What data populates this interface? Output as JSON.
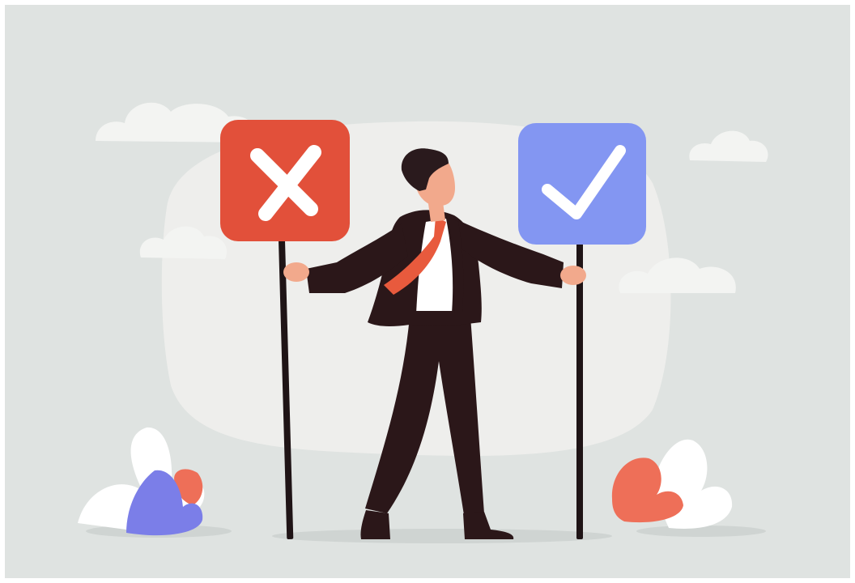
{
  "scene": {
    "subject": "businessman",
    "left_sign_icon": "x-mark-icon",
    "right_sign_icon": "check-mark-icon"
  },
  "colors": {
    "background": "#dfe3e1",
    "backdrop_blob": "#eeeeec",
    "cloud": "#f3f4f2",
    "reject_sign": "#e2503a",
    "accept_sign": "#8396f2",
    "suit": "#2b1719",
    "tie": "#e85a3d",
    "skin": "#f2a98c",
    "hair": "#2a1a1d",
    "shirt": "#ffffff",
    "pole": "#1f1416",
    "leaf_blue": "#7b7ee8",
    "leaf_red": "#ee6f58",
    "leaf_white": "#ffffff",
    "shadow": "#cfd4d2"
  }
}
